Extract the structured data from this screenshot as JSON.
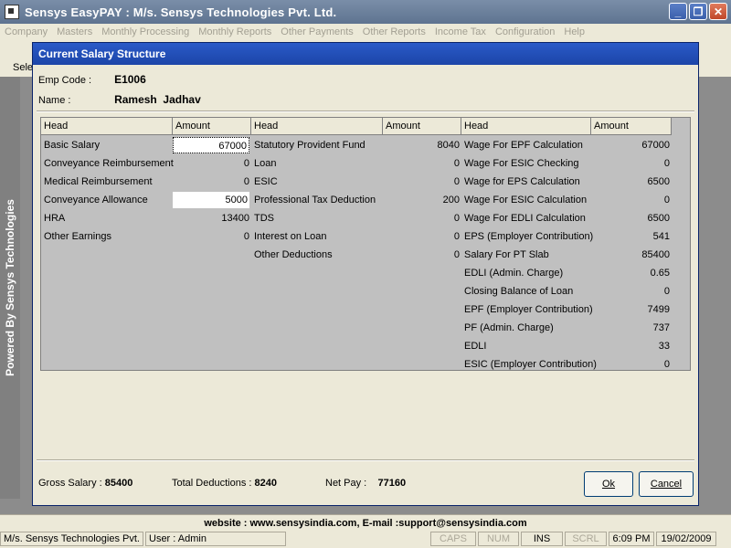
{
  "window": {
    "title": "Sensys EasyPAY : M/s. Sensys Technologies Pvt. Ltd."
  },
  "menu": [
    "Company",
    "Masters",
    "Monthly Processing",
    "Monthly Reports",
    "Other Payments",
    "Other Reports",
    "Income Tax",
    "Configuration",
    "Help"
  ],
  "background": {
    "partial_label": "Sele"
  },
  "brand_vertical": "Powered By Sensys Technologies",
  "dialog": {
    "title": "Current Salary Structure",
    "emp_code_label": "Emp Code :",
    "emp_code": "E1006",
    "name_label": "Name :",
    "name": "Ramesh  Jadhav",
    "grid": {
      "headers": [
        "Head",
        "Amount",
        "Head",
        "Amount",
        "Head",
        "Amount"
      ],
      "earnings": [
        {
          "head": "Basic Salary",
          "amount": "67000"
        },
        {
          "head": "Conveyance Reimbursement",
          "amount": "0"
        },
        {
          "head": "Medical Reimbursement",
          "amount": "0"
        },
        {
          "head": "Conveyance Allowance",
          "amount": "5000"
        },
        {
          "head": "HRA",
          "amount": "13400"
        },
        {
          "head": "Other Earnings",
          "amount": "0"
        }
      ],
      "deductions": [
        {
          "head": "Statutory Provident Fund",
          "amount": "8040"
        },
        {
          "head": "Loan",
          "amount": "0"
        },
        {
          "head": "ESIC",
          "amount": "0"
        },
        {
          "head": "Professional Tax Deduction",
          "amount": "200"
        },
        {
          "head": "TDS",
          "amount": "0"
        },
        {
          "head": "Interest on Loan",
          "amount": "0"
        },
        {
          "head": "Other Deductions",
          "amount": "0"
        }
      ],
      "calculations": [
        {
          "head": "Wage For EPF Calculation",
          "amount": "67000"
        },
        {
          "head": "Wage For ESIC Checking",
          "amount": "0"
        },
        {
          "head": "Wage for EPS Calculation",
          "amount": "6500"
        },
        {
          "head": "Wage For ESIC Calculation",
          "amount": "0"
        },
        {
          "head": "Wage For EDLI Calculation",
          "amount": "6500"
        },
        {
          "head": "EPS (Employer Contribution)",
          "amount": "541"
        },
        {
          "head": "Salary For PT Slab",
          "amount": "85400"
        },
        {
          "head": "EDLI (Admin. Charge)",
          "amount": "0.65"
        },
        {
          "head": "Closing Balance of Loan",
          "amount": "0"
        },
        {
          "head": "EPF (Employer Contribution)",
          "amount": "7499"
        },
        {
          "head": "PF (Admin. Charge)",
          "amount": "737"
        },
        {
          "head": "EDLI",
          "amount": "33"
        },
        {
          "head": "ESIC (Employer Contribution)",
          "amount": "0"
        }
      ]
    },
    "gross_label": "Gross Salary :",
    "gross_value": "85400",
    "deductions_label": "Total Deductions :",
    "deductions_value": "8240",
    "net_label": "Net Pay :",
    "net_value": "77160",
    "ok_label": "Ok",
    "cancel_label": "Cancel"
  },
  "website_bar": "website : www.sensysindia.com, E-mail :support@sensysindia.com",
  "status": {
    "company": "M/s. Sensys Technologies Pvt.",
    "user": "User : Admin",
    "caps": "CAPS",
    "num": "NUM",
    "ins": "INS",
    "scrl": "SCRL",
    "time": "6:09 PM",
    "date": "19/02/2009"
  }
}
